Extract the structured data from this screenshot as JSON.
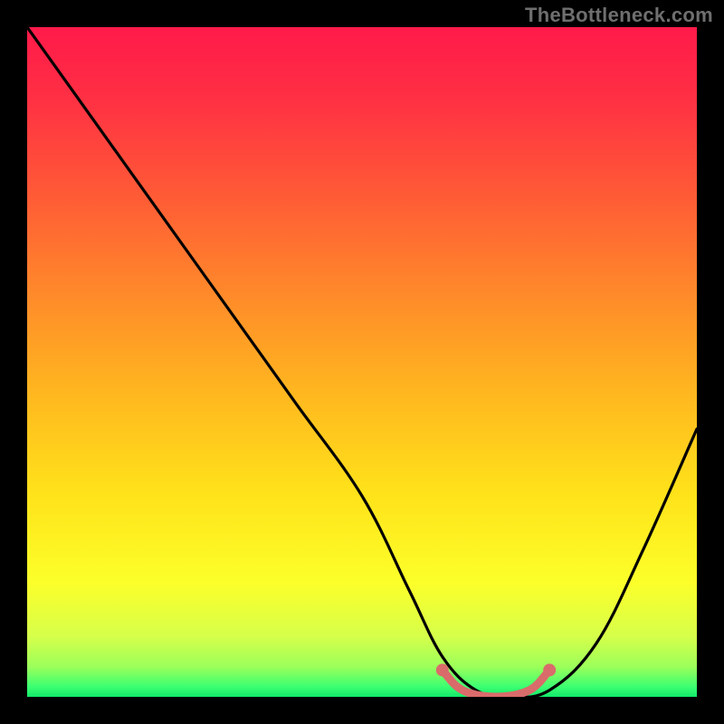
{
  "watermark": "TheBottleneck.com",
  "chart_data": {
    "type": "line",
    "title": "",
    "xlabel": "",
    "ylabel": "",
    "xlim": [
      0,
      100
    ],
    "ylim": [
      0,
      100
    ],
    "grid": false,
    "legend": false,
    "series": [
      {
        "name": "bottleneck-curve",
        "style": "black-line",
        "x": [
          0,
          10,
          20,
          30,
          40,
          50,
          57,
          62,
          67,
          72,
          78,
          85,
          92,
          100
        ],
        "y": [
          100,
          86,
          72,
          58,
          44,
          30,
          16,
          6,
          1,
          0,
          1,
          8,
          22,
          40
        ]
      },
      {
        "name": "optimal-range-highlight",
        "style": "pink-thick",
        "x": [
          62,
          65,
          70,
          75,
          78
        ],
        "y": [
          4,
          1,
          0,
          1,
          4
        ]
      }
    ],
    "gradient_stops": [
      {
        "pos": 0.0,
        "color": "#ff1a4a"
      },
      {
        "pos": 0.1,
        "color": "#ff2e44"
      },
      {
        "pos": 0.25,
        "color": "#ff5a36"
      },
      {
        "pos": 0.4,
        "color": "#ff8a2a"
      },
      {
        "pos": 0.55,
        "color": "#ffb81f"
      },
      {
        "pos": 0.7,
        "color": "#ffe31a"
      },
      {
        "pos": 0.83,
        "color": "#fcff2a"
      },
      {
        "pos": 0.91,
        "color": "#d6ff4a"
      },
      {
        "pos": 0.955,
        "color": "#9cff5a"
      },
      {
        "pos": 0.985,
        "color": "#3bff71"
      },
      {
        "pos": 1.0,
        "color": "#12e86a"
      }
    ]
  }
}
